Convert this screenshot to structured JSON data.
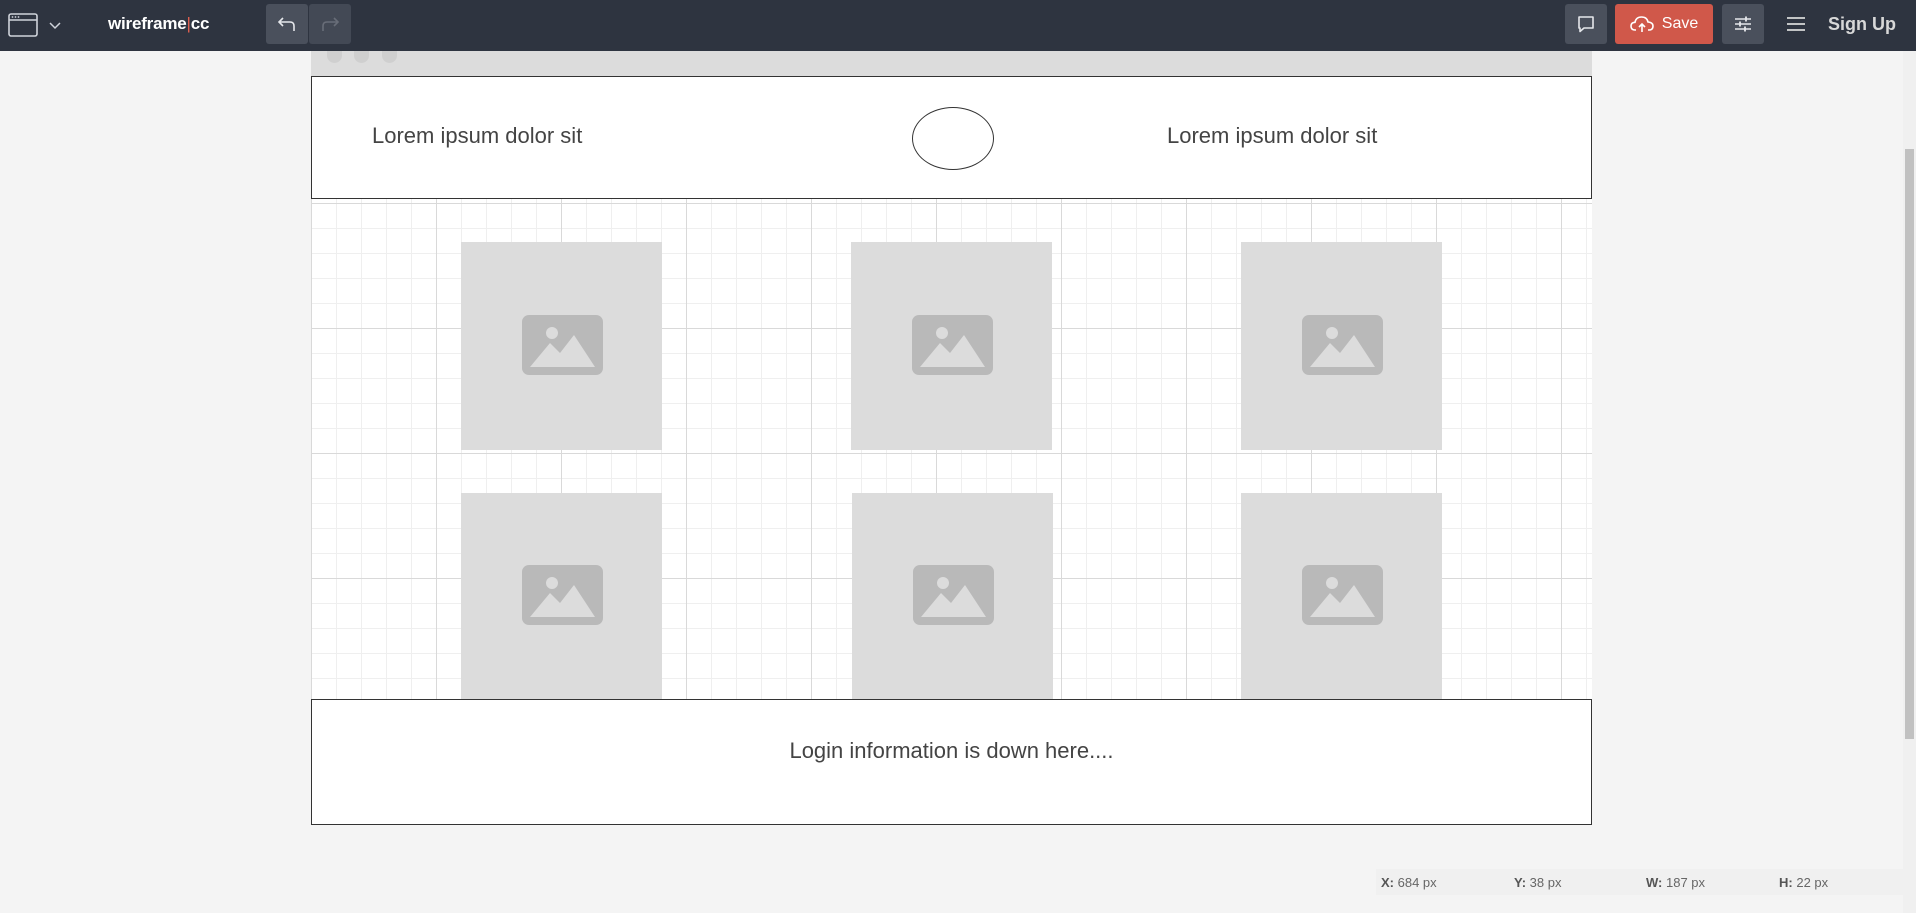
{
  "app": {
    "logo_main": "wireframe",
    "logo_sep": "|",
    "logo_tail": "cc"
  },
  "toolbar": {
    "window_menu_icon": "browser-window-icon",
    "chevron_icon": "chevron-down-icon",
    "undo_icon": "undo-arrow-icon",
    "redo_icon": "redo-arrow-icon",
    "comment_icon": "speech-bubble-icon",
    "save_icon": "cloud-upload-icon",
    "save_label": "Save",
    "settings_icon": "sliders-icon",
    "menu_icon": "hamburger-icon",
    "signup_label": "Sign Up"
  },
  "wireframe": {
    "header_left": "Lorem ipsum dolor sit",
    "header_right": "Lorem ipsum dolor sit",
    "footer_text": "Login information is down here....",
    "image_icon": "image-placeholder-icon"
  },
  "status": {
    "x_label": "X:",
    "x_value": "684 px",
    "y_label": "Y:",
    "y_value": "38 px",
    "w_label": "W:",
    "w_value": "187 px",
    "h_label": "H:",
    "h_value": "22 px"
  },
  "colors": {
    "topbar": "#2e3440",
    "save": "#d0584a",
    "placeholder": "#dcdcdc"
  }
}
